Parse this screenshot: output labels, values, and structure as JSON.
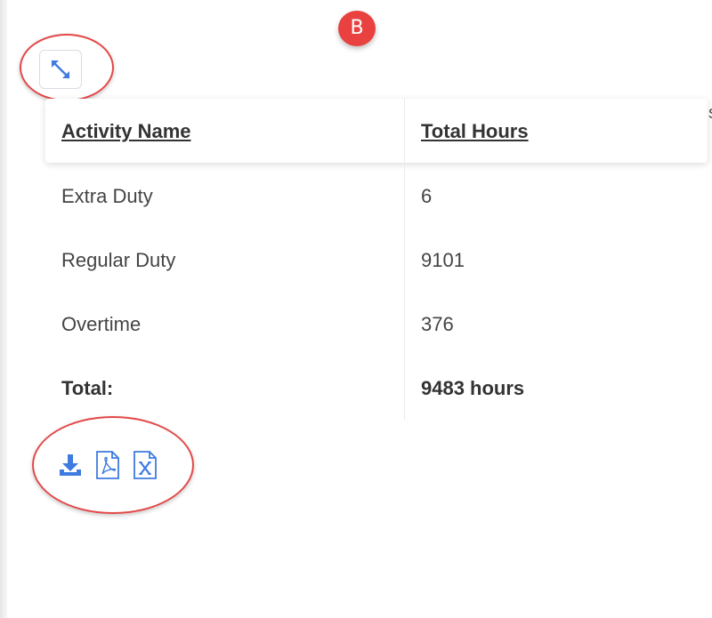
{
  "marker": {
    "label": "B"
  },
  "toolbar": {
    "expand_icon": "expand-arrows-icon"
  },
  "table": {
    "columns": [
      "Activity Name",
      "Total Hours"
    ],
    "rows": [
      {
        "activity": "Extra Duty",
        "hours": "6"
      },
      {
        "activity": "Regular Duty",
        "hours": "9101"
      },
      {
        "activity": "Overtime",
        "hours": "376"
      }
    ],
    "total": {
      "label": "Total:",
      "value": "9483 hours"
    }
  },
  "export": {
    "icons": [
      "download-icon",
      "pdf-file-icon",
      "excel-file-icon"
    ]
  },
  "stray_text": "s",
  "colors": {
    "accent": "#3f7be0",
    "annotation_red": "#e34848",
    "marker_red": "#e8413f"
  }
}
